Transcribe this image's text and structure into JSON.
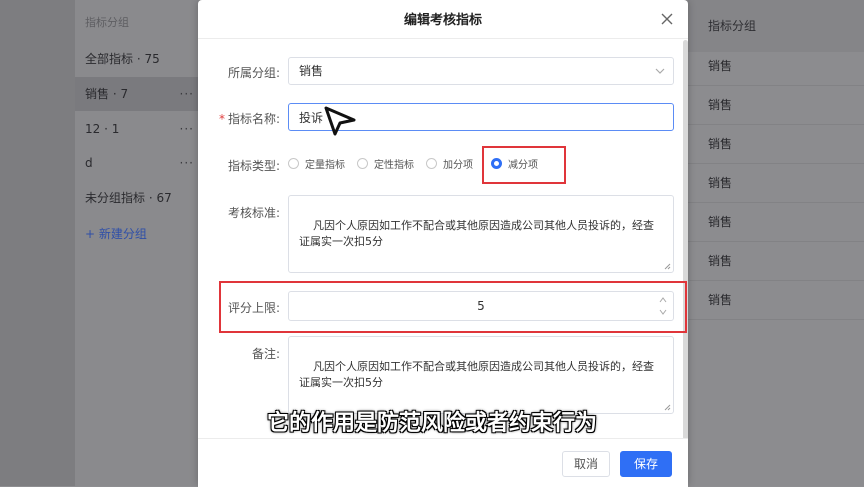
{
  "background": {
    "group_header": "指标分组",
    "groups": [
      {
        "label": "全部指标 · 75",
        "more": ""
      },
      {
        "label": "销售 · 7",
        "more": "···"
      },
      {
        "label": "12 · 1",
        "more": "···"
      },
      {
        "label": "d",
        "more": "···"
      },
      {
        "label": "未分组指标 · 67",
        "more": ""
      }
    ],
    "new_group": "+ 新建分组",
    "column_header": "指标分组",
    "rows": [
      "销售",
      "销售",
      "销售",
      "销售",
      "销售",
      "销售",
      "销售"
    ]
  },
  "modal": {
    "title": "编辑考核指标",
    "group_label": "所属分组:",
    "group_value": "销售",
    "name_required": "*",
    "name_label": "指标名称:",
    "name_value": "投诉",
    "type_label": "指标类型:",
    "type_options": [
      "定量指标",
      "定性指标",
      "加分项",
      "减分项"
    ],
    "type_selected": "减分项",
    "standard_label": "考核标准:",
    "standard_value": "凡因个人原因如工作不配合或其他原因造成公司其他人员投诉的，经查\n证属实一次扣5分",
    "limit_label": "评分上限:",
    "limit_value": "5",
    "remark_label": "备注:",
    "remark_value": "凡因个人原因如工作不配合或其他原因造成公司其他人员投诉的，经查\n证属实一次扣5分",
    "cancel_label": "取消",
    "save_label": "保存"
  },
  "subtitle": "它的作用是防范风险或者约束行为",
  "colors": {
    "primary": "#2f6ff5",
    "highlight": "#e0353a",
    "overlay": "#8e8e91"
  }
}
